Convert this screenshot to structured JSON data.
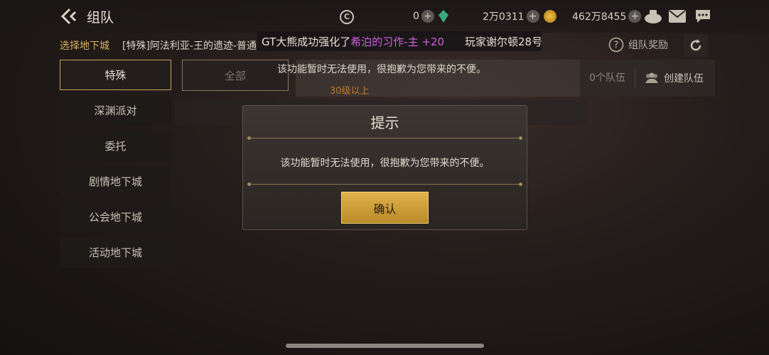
{
  "header": {
    "title": "组队",
    "currency_1": "0",
    "currency_2": "2万0311",
    "currency_3": "462万8455",
    "coin_symbol": "C"
  },
  "ticker": {
    "part1": "GT大熊成功强化了",
    "highlight": "希泊的习作-主 +20",
    "part2": "玩家谢尔顿28号"
  },
  "selector": {
    "label": "选择地下城",
    "value": "[特殊]阿法利亚-王的遗迹-普通"
  },
  "reward_label": "组队奖励",
  "sidebar": {
    "items": [
      {
        "label": "特殊",
        "active": true
      },
      {
        "label": "深渊派对",
        "active": false
      },
      {
        "label": "委托",
        "active": false
      },
      {
        "label": "剧情地下城",
        "active": false
      },
      {
        "label": "公会地下城",
        "active": false
      },
      {
        "label": "活动地下城",
        "active": false
      }
    ]
  },
  "filter": {
    "tab_all": "全部",
    "level": "30级以上",
    "team_count": "0个队伍",
    "create_team": "创建队伍"
  },
  "background_tip": "该功能暂时无法使用，很抱歉为您带来的不便。",
  "modal": {
    "title": "提示",
    "message": "该功能暂时无法使用，很抱歉为您带来的不便。",
    "confirm": "确认"
  },
  "colors": {
    "accent_gold": "#d8b060",
    "highlight_purple": "#d060e0",
    "button_gold": "#e0b24c"
  }
}
